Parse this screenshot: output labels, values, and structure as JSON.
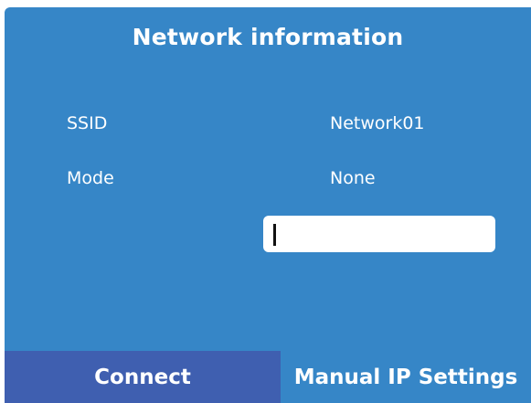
{
  "panel": {
    "title": "Network information",
    "bg_color": "#3686c7"
  },
  "fields": {
    "ssid_label": "SSID",
    "ssid_value": "Network01",
    "mode_label": "Mode",
    "mode_value": "None"
  },
  "password_input": {
    "value": "",
    "placeholder": ""
  },
  "buttons": {
    "connect": "Connect",
    "manual_ip": "Manual IP Settings",
    "connect_color": "#3f5fb0"
  }
}
